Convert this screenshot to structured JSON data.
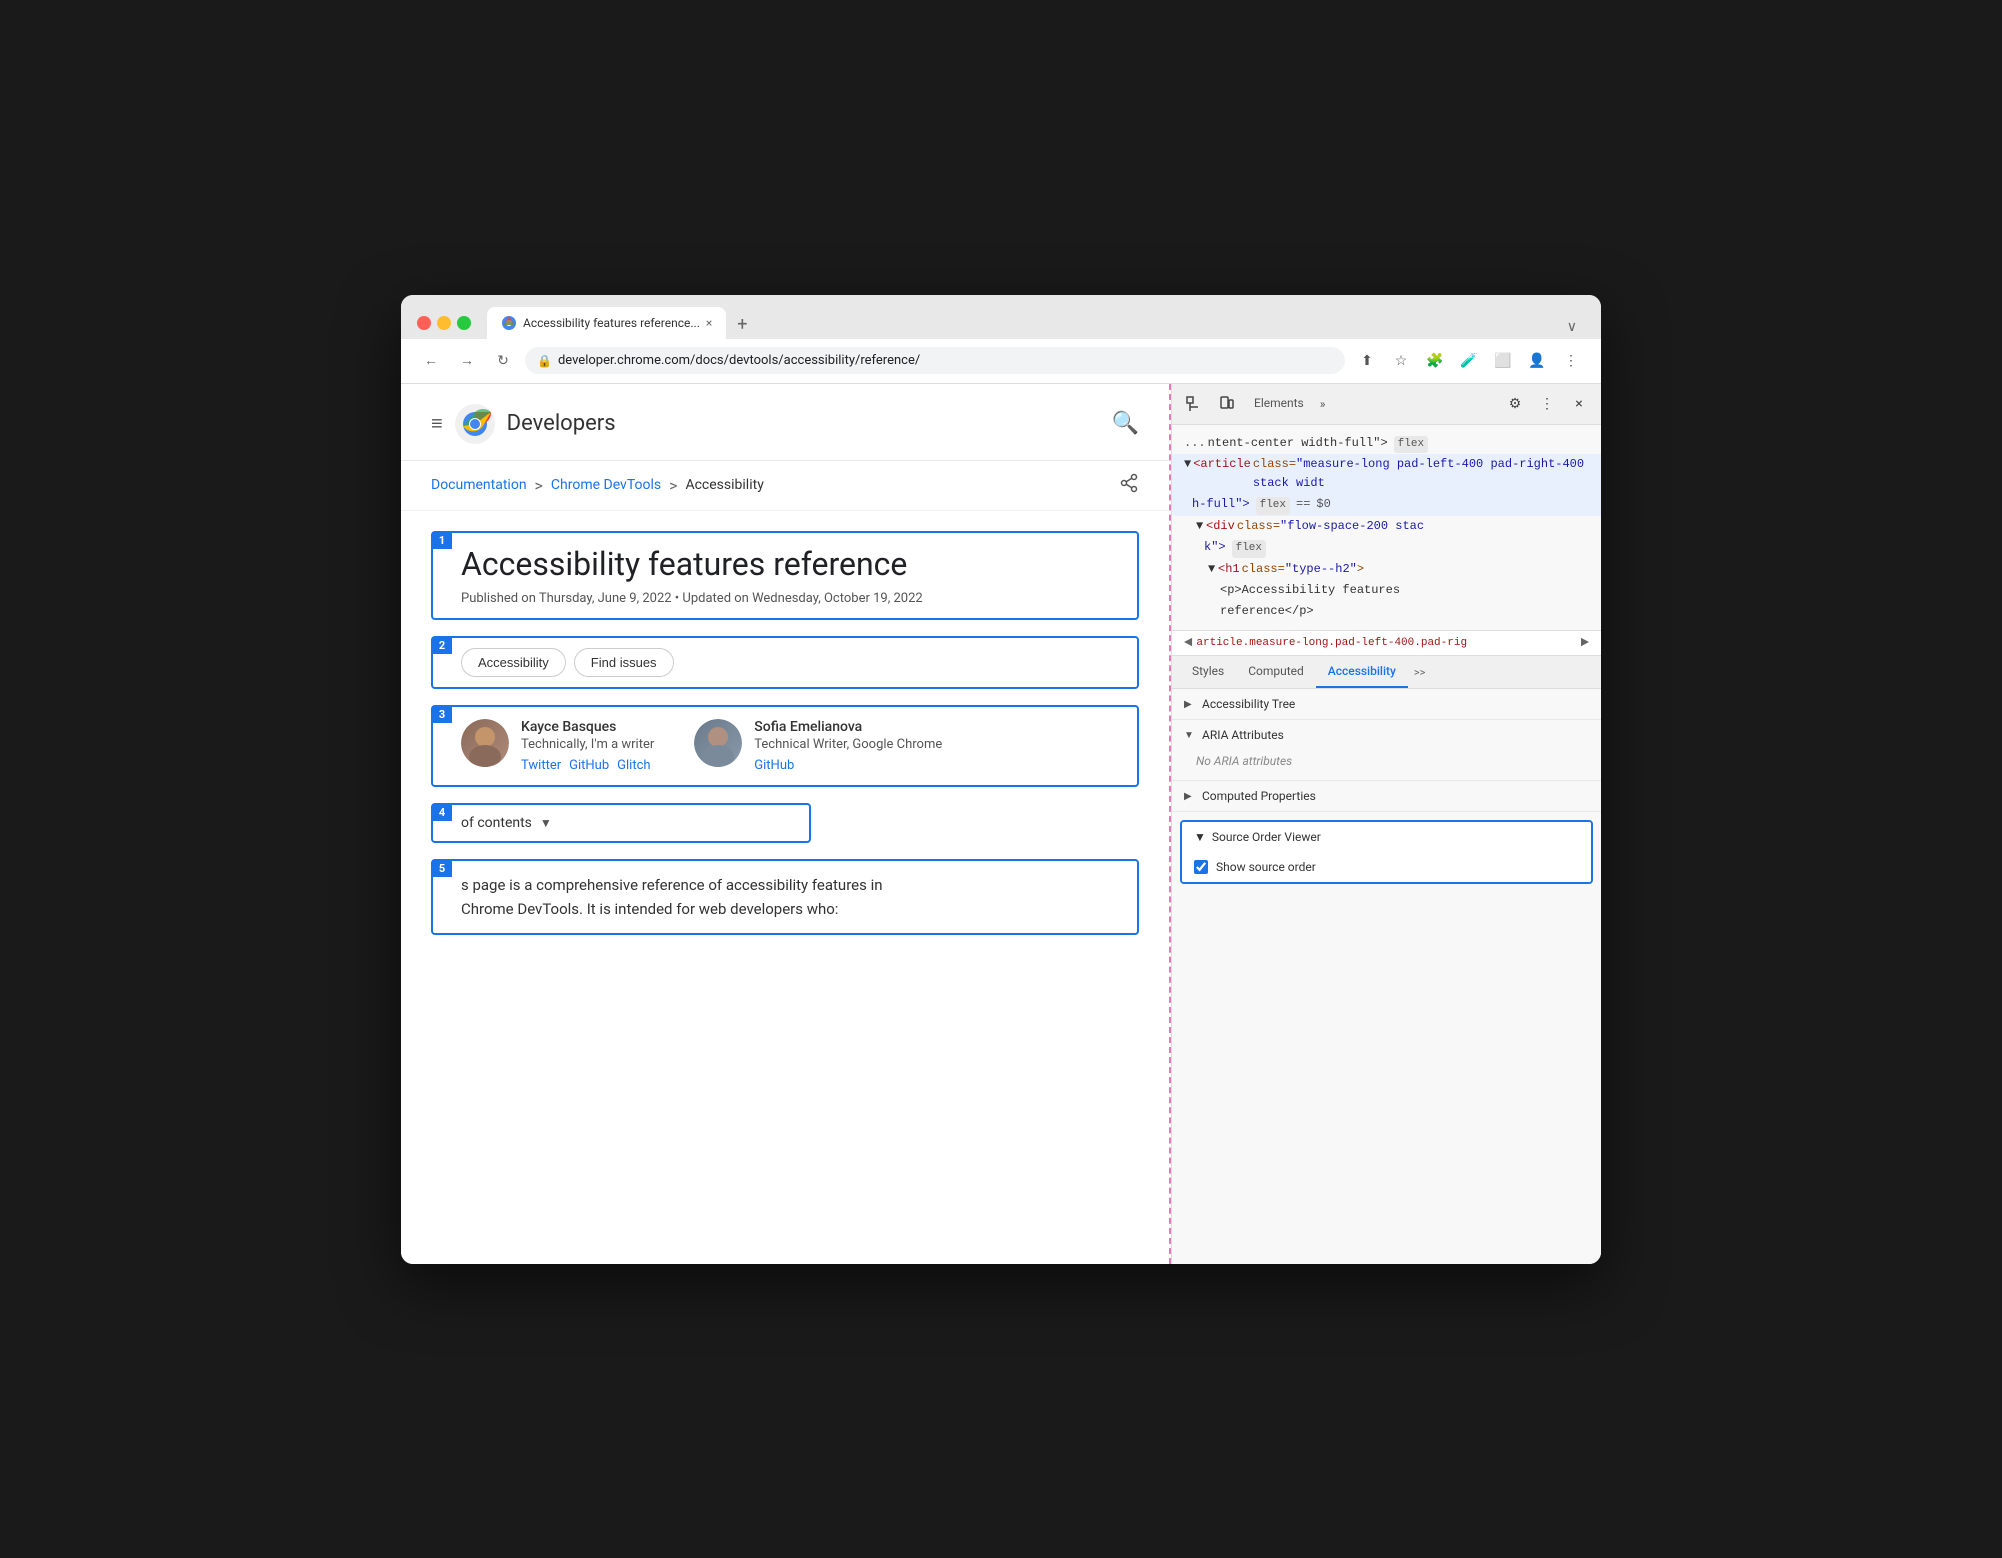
{
  "browser": {
    "tab_title": "Accessibility features reference...",
    "tab_close": "×",
    "new_tab": "+",
    "tab_dropdown": "∨",
    "url": "developer.chrome.com/docs/devtools/accessibility/reference/",
    "url_full": "developer.chrome.com/docs/devtools/accessibility/reference/",
    "nav_back": "←",
    "nav_forward": "→",
    "nav_reload": "↻",
    "toolbar_share": "⬆",
    "toolbar_star": "☆",
    "toolbar_extension": "🧩",
    "toolbar_dropper": "🧪",
    "toolbar_layout": "⬜",
    "toolbar_account": "👤",
    "toolbar_menu": "⋮"
  },
  "page": {
    "hamburger": "≡",
    "site_name": "Developers",
    "search_icon": "🔍",
    "breadcrumb": {
      "doc_link": "Documentation",
      "sep1": ">",
      "devtools_link": "Chrome DevTools",
      "sep2": ">",
      "current": "Accessibility"
    },
    "share_icon": "share",
    "source_boxes": {
      "box1": {
        "number": "1",
        "title": "Accessibility features reference",
        "published": "Published on Thursday, June 9, 2022 • Updated on Wednesday, October 19, 2022"
      },
      "box2": {
        "number": "2",
        "tab1": "Accessibility",
        "tab2": "Find issues"
      },
      "box3": {
        "number": "3",
        "author1_name": "Kayce Basques",
        "author1_role": "Technically, I'm a writer",
        "author1_twitter": "Twitter",
        "author1_github": "GitHub",
        "author1_glitch": "Glitch",
        "author2_name": "Sofia Emelianova",
        "author2_role": "Technical Writer, Google Chrome",
        "author2_github": "GitHub"
      },
      "box4": {
        "number": "4",
        "toc_label": "of contents",
        "toc_arrow": "▼"
      },
      "box5": {
        "number": "5",
        "text_line1": "s page is a comprehensive reference of accessibility features in",
        "text_line2": "Chrome DevTools. It is intended for web developers who:"
      }
    }
  },
  "devtools": {
    "toolbar": {
      "inspect_icon": "⬚",
      "device_icon": "⬛",
      "panel_label": "Elements",
      "more": "»",
      "settings": "⚙",
      "menu": "⋮",
      "close": "×"
    },
    "html_tree": {
      "line1": "ntent-center width-full\">",
      "line1_badge": "flex",
      "line2_tag": "<article",
      "line2_attr": "class=\"measure-long pad-left-400 pad-right-400 stack widt",
      "line3_continuation": "h-full\">",
      "line3_badge1": "flex",
      "line3_eq": "==",
      "line3_dollar": "$0",
      "line4_tag": "<div",
      "line4_attr": "class=\"flow-space-200 stac",
      "line5_continuation": "k\">",
      "line5_badge": "flex",
      "line6_tag": "<h1",
      "line6_attr": "class=\"type--h2\">",
      "line7_p": "<p>Accessibility features",
      "line8_p": "reference</p>"
    },
    "breadcrumb": "article.measure-long.pad-left-400.pad-rig",
    "panel_tabs": {
      "styles": "Styles",
      "computed": "Computed",
      "accessibility": "Accessibility",
      "more": ">>"
    },
    "a11y": {
      "tree_label": "Accessibility Tree",
      "aria_label": "ARIA Attributes",
      "aria_empty": "No ARIA attributes",
      "computed_label": "Computed Properties",
      "sov_label": "Source Order Viewer",
      "sov_toggle": "▼",
      "sov_checkbox_label": "Show source order",
      "tree_toggle_open": "▶",
      "aria_toggle": "▼",
      "computed_toggle": "▶"
    }
  }
}
